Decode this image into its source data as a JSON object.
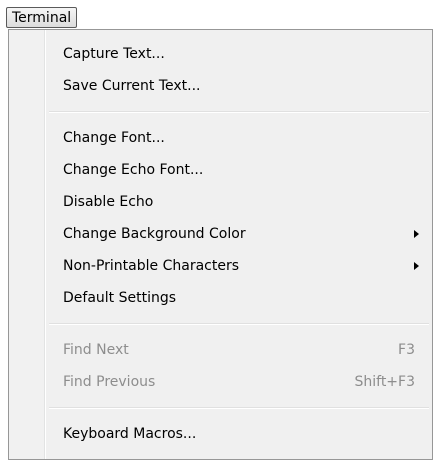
{
  "menubar": {
    "title": "Terminal"
  },
  "menu": {
    "items": [
      {
        "label": "Capture Text..."
      },
      {
        "label": "Save Current Text..."
      },
      {
        "label": "Change Font..."
      },
      {
        "label": "Change Echo Font..."
      },
      {
        "label": "Disable Echo"
      },
      {
        "label": "Change Background Color",
        "has_submenu": true
      },
      {
        "label": "Non-Printable Characters",
        "has_submenu": true
      },
      {
        "label": "Default Settings"
      },
      {
        "label": "Find Next",
        "shortcut": "F3",
        "disabled": true
      },
      {
        "label": "Find Previous",
        "shortcut": "Shift+F3",
        "disabled": true
      },
      {
        "label": "Keyboard Macros..."
      }
    ]
  }
}
